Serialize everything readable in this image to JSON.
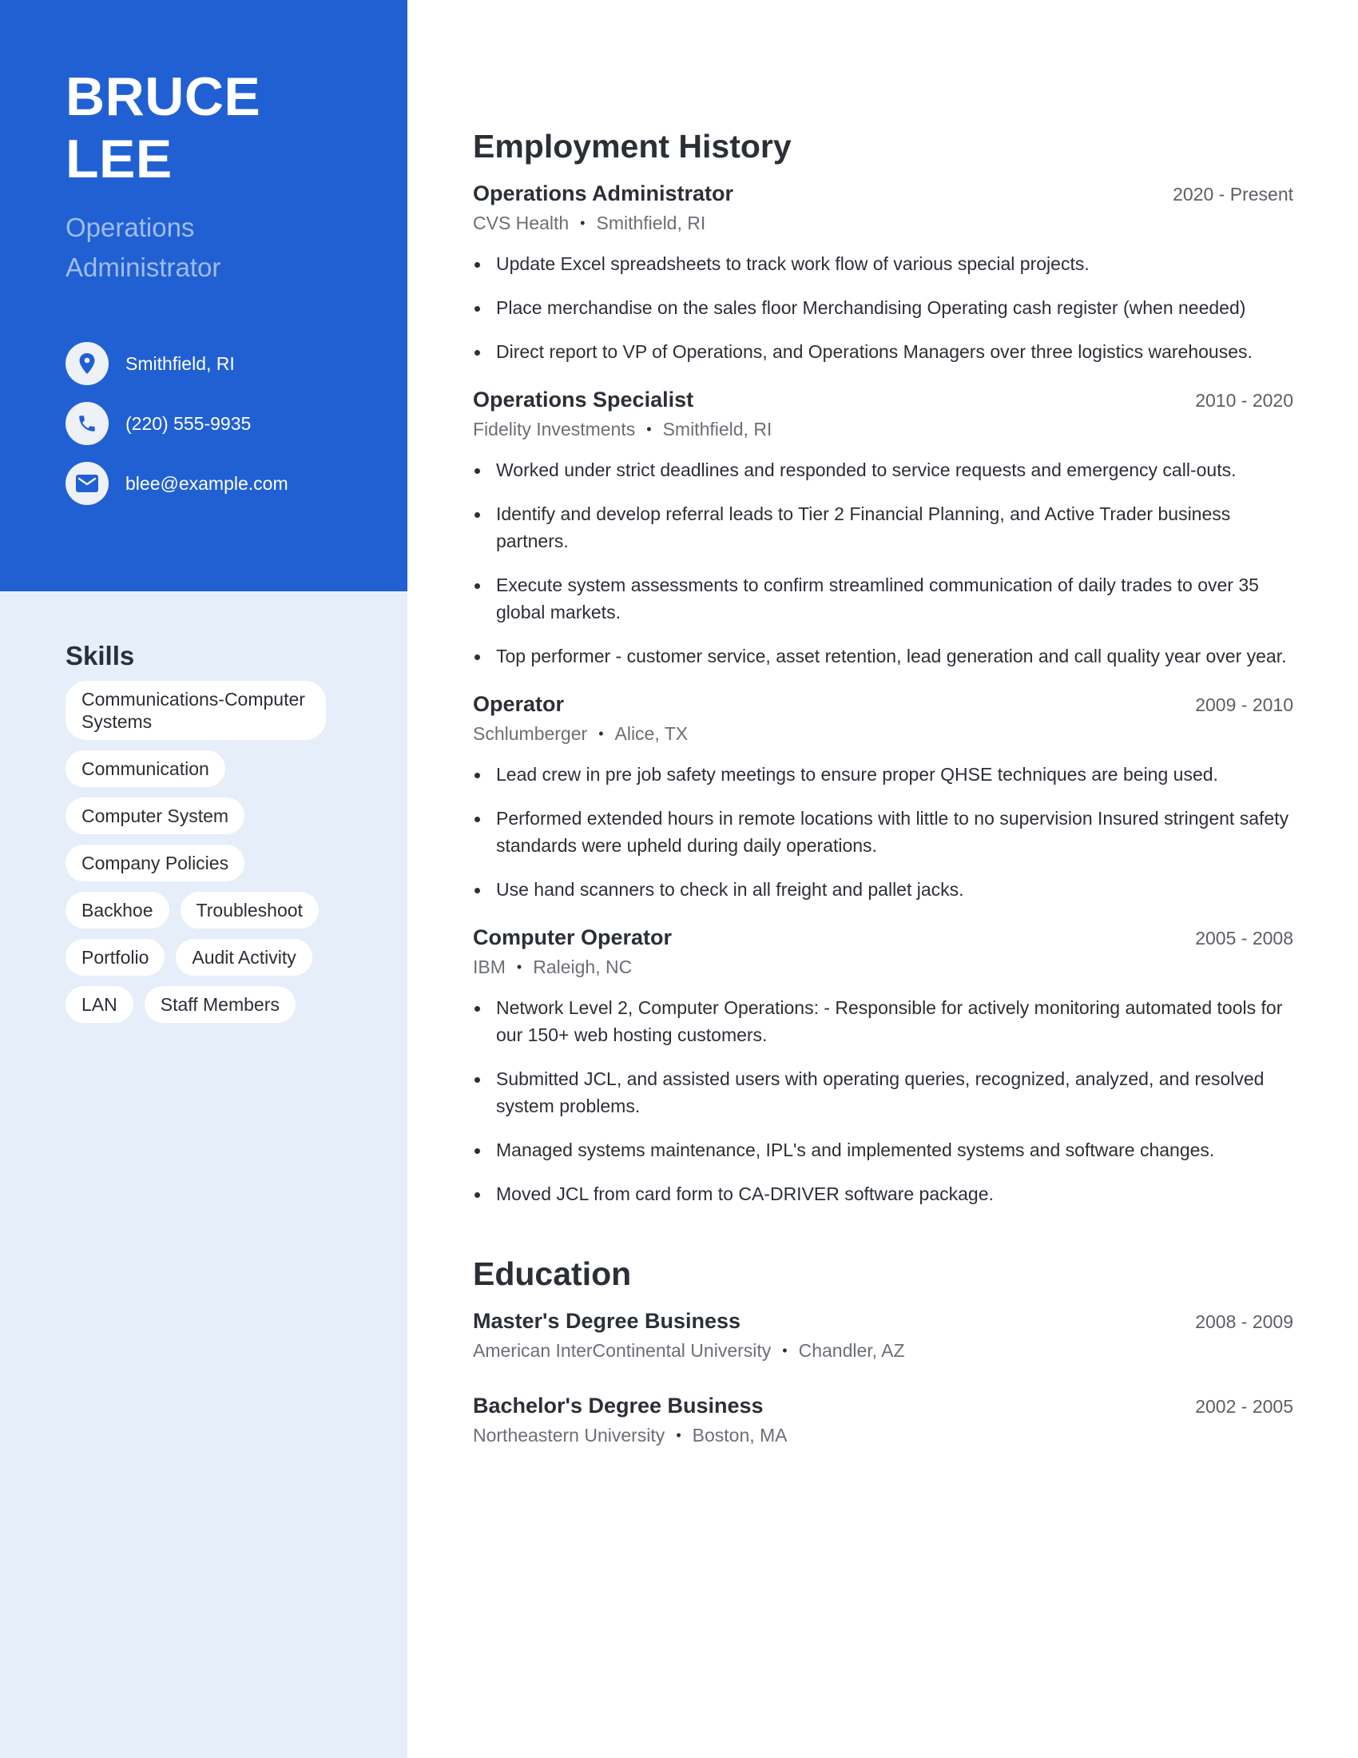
{
  "profile": {
    "first_name": "BRUCE",
    "last_name": "LEE",
    "title": "Operations Administrator",
    "accent_color": "#2160d2",
    "sidebar_light_color": "#e6eef9"
  },
  "contacts": [
    {
      "icon": "location-pin-icon",
      "text": "Smithfield, RI"
    },
    {
      "icon": "phone-icon",
      "text": "(220) 555-9935"
    },
    {
      "icon": "envelope-icon",
      "text": "blee@example.com"
    }
  ],
  "skills": {
    "heading": "Skills",
    "items": [
      "Communications-Computer Systems",
      "Communication",
      "Computer System",
      "Company Policies",
      "Backhoe",
      "Troubleshoot",
      "Portfolio",
      "Audit Activity",
      "LAN",
      "Staff Members"
    ]
  },
  "employment": {
    "heading": "Employment History",
    "jobs": [
      {
        "title": "Operations Administrator",
        "dates": "2020 - Present",
        "company": "CVS Health",
        "location": "Smithfield, RI",
        "bullets": [
          "Update Excel spreadsheets to track work flow of various special projects.",
          "Place merchandise on the sales floor Merchandising Operating cash register (when needed)",
          "Direct report to VP of Operations, and Operations Managers over three logistics warehouses."
        ]
      },
      {
        "title": "Operations Specialist",
        "dates": "2010 - 2020",
        "company": "Fidelity Investments",
        "location": "Smithfield, RI",
        "bullets": [
          "Worked under strict deadlines and responded to service requests and emergency call-outs.",
          "Identify and develop referral leads to Tier 2 Financial Planning, and Active Trader business partners.",
          "Execute system assessments to confirm streamlined communication of daily trades to over 35 global markets.",
          "Top performer - customer service, asset retention, lead generation and call quality year over year."
        ]
      },
      {
        "title": "Operator",
        "dates": "2009 - 2010",
        "company": "Schlumberger",
        "location": "Alice, TX",
        "bullets": [
          "Lead crew in pre job safety meetings to ensure proper QHSE techniques are being used.",
          "Performed extended hours in remote locations with little to no supervision Insured stringent safety standards were upheld during daily operations.",
          "Use hand scanners to check in all freight and pallet jacks."
        ]
      },
      {
        "title": "Computer Operator",
        "dates": "2005 - 2008",
        "company": "IBM",
        "location": "Raleigh, NC",
        "bullets": [
          "Network Level 2, Computer Operations: - Responsible for actively monitoring automated tools for our 150+ web hosting customers.",
          "Submitted JCL, and assisted users with operating queries, recognized, analyzed, and resolved system problems.",
          "Managed systems maintenance, IPL's and implemented systems and software changes.",
          "Moved JCL from card form to CA-DRIVER software package."
        ]
      }
    ]
  },
  "education": {
    "heading": "Education",
    "items": [
      {
        "degree": "Master's Degree Business",
        "dates": "2008 - 2009",
        "school": "American InterContinental University",
        "location": "Chandler, AZ"
      },
      {
        "degree": "Bachelor's Degree Business",
        "dates": "2002 - 2005",
        "school": "Northeastern University",
        "location": "Boston, MA"
      }
    ]
  },
  "separator_glyph": "•"
}
